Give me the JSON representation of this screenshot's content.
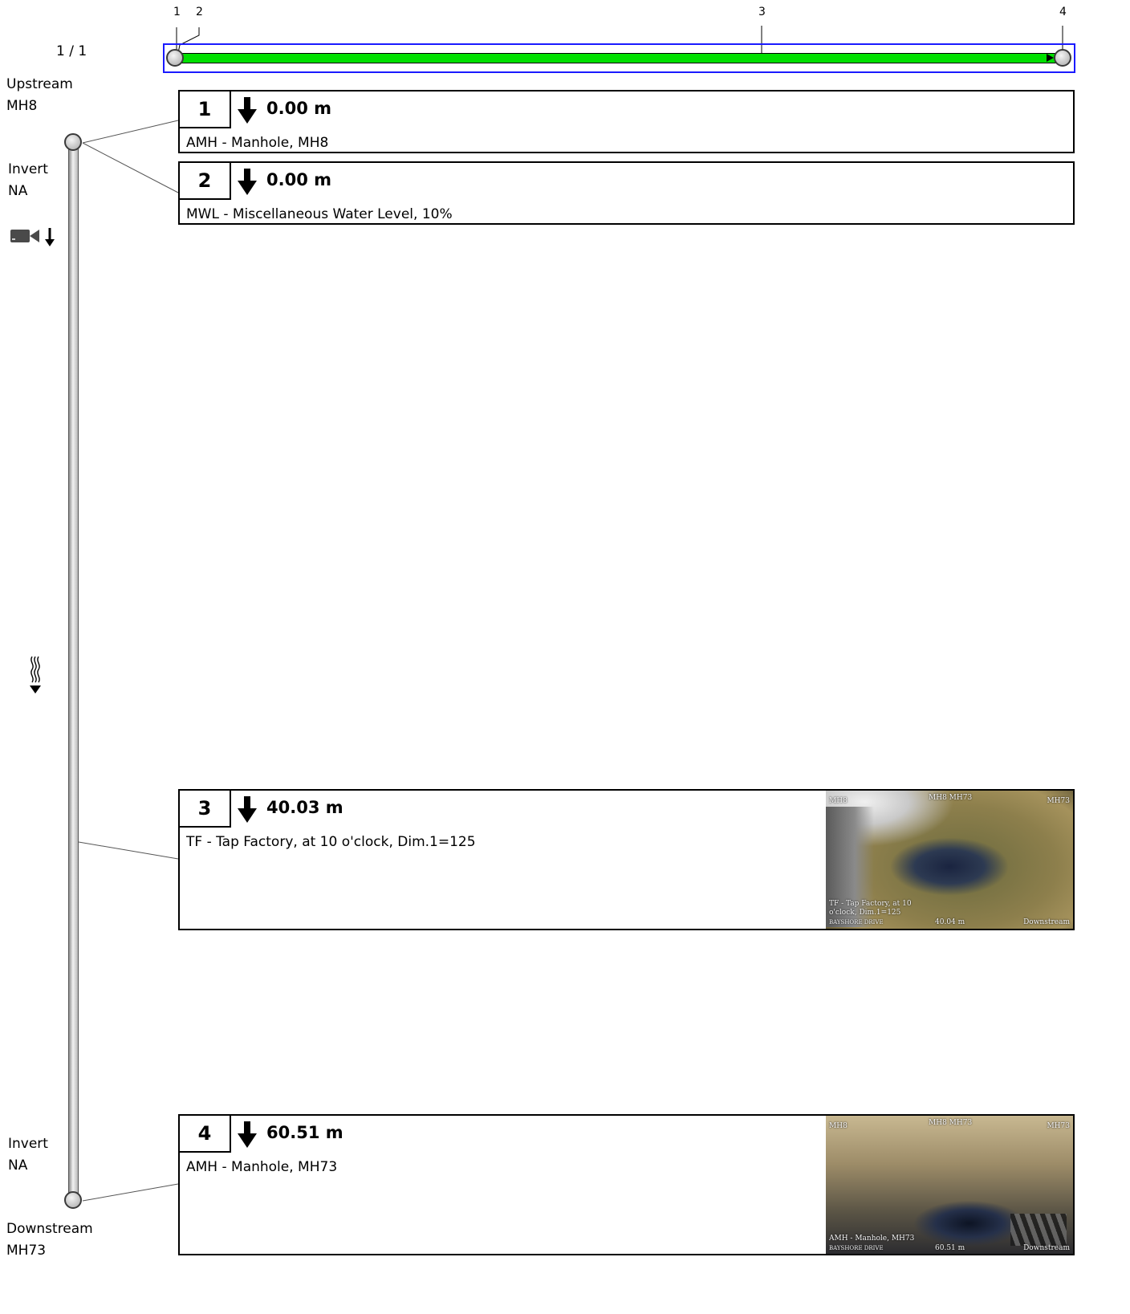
{
  "page_indicator": "1 / 1",
  "ticks": [
    {
      "label": "1"
    },
    {
      "label": "2"
    },
    {
      "label": "3"
    },
    {
      "label": "4"
    }
  ],
  "upstream": {
    "title": "Upstream",
    "node": "MH8"
  },
  "invert_top": {
    "title": "Invert",
    "value": "NA"
  },
  "invert_bottom": {
    "title": "Invert",
    "value": "NA"
  },
  "downstream": {
    "title": "Downstream",
    "node": "MH73"
  },
  "icons": {
    "direction": "camera-downstream-icon",
    "water_level": "water-level-icon"
  },
  "colors": {
    "pipe_fill": "#00e000",
    "overview_border": "#1a1aff"
  },
  "observations": [
    {
      "number": "1",
      "distance": "0.00 m",
      "description": "AMH - Manhole, MH8"
    },
    {
      "number": "2",
      "distance": "0.00 m",
      "description": "MWL - Miscellaneous Water Level, 10%"
    },
    {
      "number": "3",
      "distance": "40.03 m",
      "description": "TF - Tap Factory, at 10 o'clock, Dim.1=125",
      "photo": {
        "header_left": "MH8",
        "header_center": "MH8 MH73",
        "header_right": "MH73",
        "caption_line1": "TF - Tap Factory, at 10",
        "caption_line2": "o'clock, Dim.1=125",
        "street": "BAYSHORE DRIVE",
        "distance": "40.04 m",
        "direction": "Downstream"
      }
    },
    {
      "number": "4",
      "distance": "60.51 m",
      "description": "AMH - Manhole, MH73",
      "photo": {
        "header_left": "MH8",
        "header_center": "MH8 MH73",
        "header_right": "MH73",
        "caption_line1": "AMH - Manhole, MH73",
        "street": "BAYSHORE DRIVE",
        "distance": "60.51 m",
        "direction": "Downstream"
      }
    }
  ]
}
